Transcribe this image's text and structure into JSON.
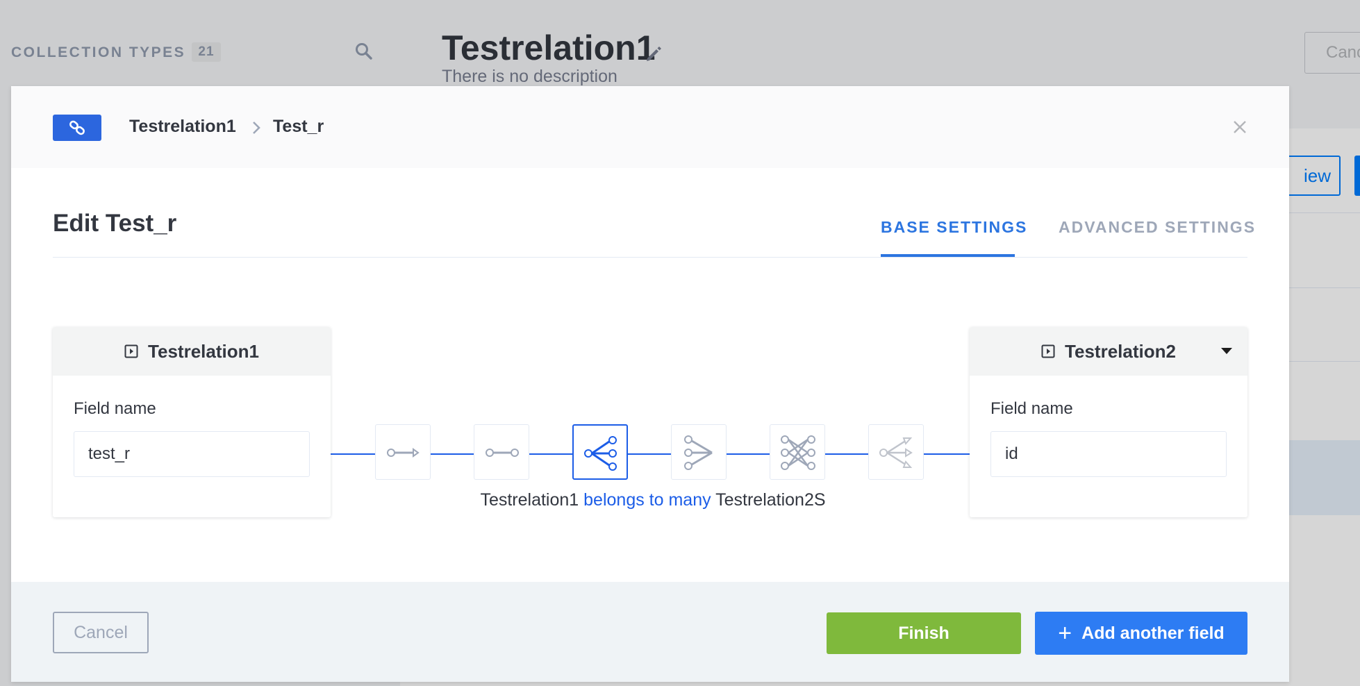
{
  "background": {
    "sidebar": {
      "section_label": "COLLECTION TYPES",
      "count": "21"
    },
    "page": {
      "title": "Testrelation1",
      "description": "There is no description",
      "cancel_label": "Canc",
      "view_label": "iew"
    }
  },
  "modal": {
    "breadcrumb": {
      "parent": "Testrelation1",
      "current": "Test_r"
    },
    "title": "Edit Test_r",
    "tabs": [
      {
        "label": "BASE SETTINGS",
        "active": true
      },
      {
        "label": "ADVANCED SETTINGS",
        "active": false
      }
    ],
    "left_card": {
      "name": "Testrelation1",
      "field_label": "Field name",
      "field_value": "test_r"
    },
    "right_card": {
      "name": "Testrelation2",
      "field_label": "Field name",
      "field_value": "id"
    },
    "relation_types": [
      {
        "icon": "one-way-icon",
        "active": false
      },
      {
        "icon": "one-to-one-icon",
        "active": false
      },
      {
        "icon": "one-to-many-icon",
        "active": true
      },
      {
        "icon": "many-to-one-icon",
        "active": false
      },
      {
        "icon": "many-to-many-icon",
        "active": false
      },
      {
        "icon": "many-way-icon",
        "active": false
      }
    ],
    "caption": {
      "left": "Testrelation1",
      "relation": "belongs to many",
      "right": "Testrelation2S"
    },
    "footer": {
      "cancel_label": "Cancel",
      "finish_label": "Finish",
      "add_label": "Add another field",
      "add_icon": "+"
    }
  },
  "colors": {
    "primary": "#2c75e0",
    "success": "#7fb93c",
    "link_line": "#1c5de7"
  }
}
